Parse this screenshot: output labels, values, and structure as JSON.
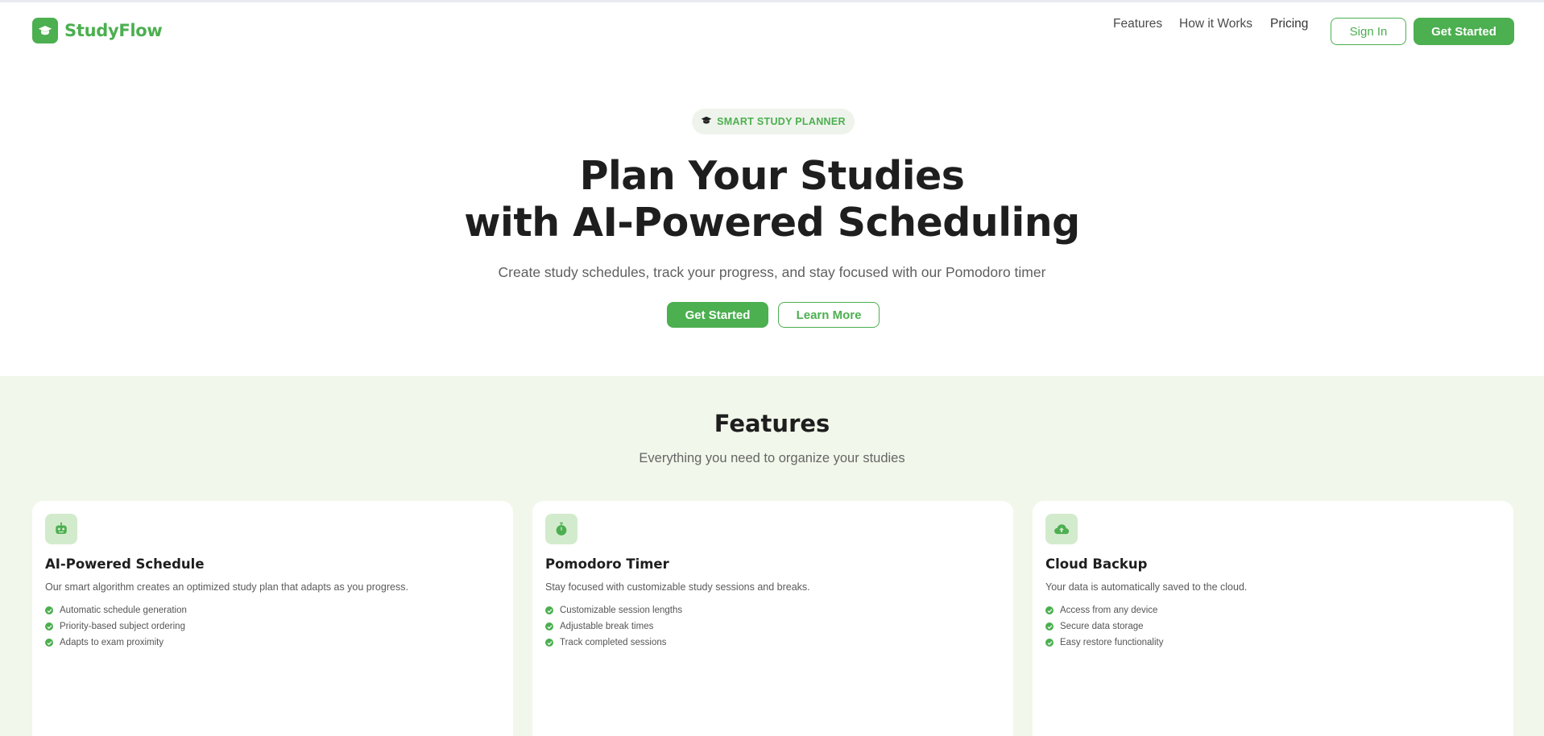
{
  "header": {
    "brand": "StudyFlow",
    "nav": [
      "Features",
      "How it Works",
      "Pricing"
    ],
    "sign_in": "Sign In",
    "get_started": "Get Started"
  },
  "hero": {
    "badge_icon": "graduation-cap-icon",
    "badge": "SMART STUDY PLANNER",
    "title_line1": "Plan Your Studies",
    "title_line2": "with AI-Powered Scheduling",
    "subtitle": "Create study schedules, track your progress, and stay focused with our Pomodoro timer",
    "primary_cta": "Get Started",
    "secondary_cta": "Learn More"
  },
  "features": {
    "title": "Features",
    "subtitle": "Everything you need to organize your studies",
    "cards": [
      {
        "icon": "robot-icon",
        "title": "AI-Powered Schedule",
        "description": "Our smart algorithm creates an optimized study plan that adapts as you progress.",
        "items": [
          "Automatic schedule generation",
          "Priority-based subject ordering",
          "Adapts to exam proximity"
        ]
      },
      {
        "icon": "stopwatch-icon",
        "title": "Pomodoro Timer",
        "description": "Stay focused with customizable study sessions and breaks.",
        "items": [
          "Customizable session lengths",
          "Adjustable break times",
          "Track completed sessions"
        ]
      },
      {
        "icon": "cloud-upload-icon",
        "title": "Cloud Backup",
        "description": "Your data is automatically saved to the cloud.",
        "items": [
          "Access from any device",
          "Secure data storage",
          "Easy restore functionality"
        ]
      }
    ]
  },
  "colors": {
    "accent": "#4caf50",
    "features_bg": "#f1f7ea",
    "icon_bg": "#d3ebcd"
  }
}
